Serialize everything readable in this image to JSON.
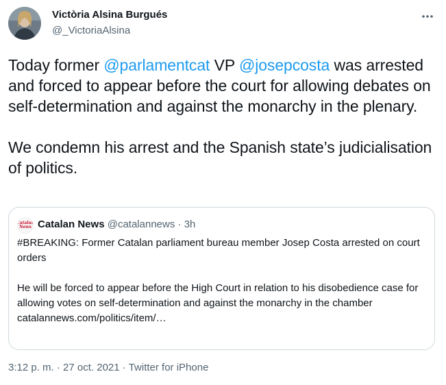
{
  "author": {
    "name": "Victòria Alsina Burgués",
    "handle": "@_VictoriaAlsina"
  },
  "tweet": {
    "paragraph1": {
      "part1": "Today former ",
      "mention1": "@parlamentcat",
      "part2": " VP ",
      "mention2": "@josepcosta",
      "part3": " was arrested and forced to appear before the court for allowing debates on self-determination and against the monarchy in the plenary."
    },
    "paragraph2": "We condemn his arrest and the Spanish state’s judicialisation of politics."
  },
  "quote": {
    "avatar_text": "Catalan News",
    "name": "Catalan News",
    "handle": "@catalannews",
    "separator": "·",
    "time": "3h",
    "paragraph1": "#BREAKING: Former Catalan parliament bureau member Josep Costa arrested on court orders",
    "paragraph2": "He will be forced to appear before the High Court in relation to his disobedience case for allowing votes on self-determination and against the monarchy in the chamber",
    "link": "catalannews.com/politics/item/…"
  },
  "footer": {
    "time": "3:12 p. m.",
    "separator1": " · ",
    "date": "27 oct. 2021",
    "separator2": " · ",
    "source": "Twitter for iPhone"
  },
  "colors": {
    "text": "#0f1419",
    "secondary": "#536471",
    "link": "#1d9bf0",
    "border": "#cfd9de"
  },
  "icons": {
    "more": "more-horizontal-icon"
  }
}
